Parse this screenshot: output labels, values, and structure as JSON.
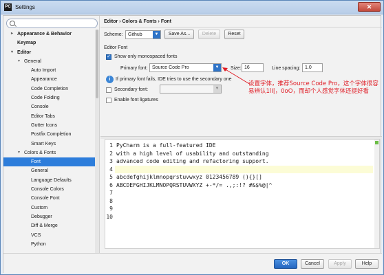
{
  "window": {
    "title": "Settings",
    "app_icon": "PC",
    "close": "✕"
  },
  "sidebar": {
    "search_placeholder": "",
    "items": [
      {
        "label": "Appearance & Behavior",
        "bold": true,
        "arrow": "▸",
        "level": 0
      },
      {
        "label": "Keymap",
        "bold": true,
        "arrow": "",
        "level": 0
      },
      {
        "label": "Editor",
        "bold": true,
        "arrow": "▾",
        "level": 0
      },
      {
        "label": "General",
        "bold": false,
        "arrow": "▾",
        "level": 1
      },
      {
        "label": "Auto Import",
        "bold": false,
        "arrow": "",
        "level": 2
      },
      {
        "label": "Appearance",
        "bold": false,
        "arrow": "",
        "level": 2
      },
      {
        "label": "Code Completion",
        "bold": false,
        "arrow": "",
        "level": 2
      },
      {
        "label": "Code Folding",
        "bold": false,
        "arrow": "",
        "level": 2
      },
      {
        "label": "Console",
        "bold": false,
        "arrow": "",
        "level": 2
      },
      {
        "label": "Editor Tabs",
        "bold": false,
        "arrow": "",
        "level": 2
      },
      {
        "label": "Gutter Icons",
        "bold": false,
        "arrow": "",
        "level": 2
      },
      {
        "label": "Postfix Completion",
        "bold": false,
        "arrow": "",
        "level": 2
      },
      {
        "label": "Smart Keys",
        "bold": false,
        "arrow": "",
        "level": 2
      },
      {
        "label": "Colors & Fonts",
        "bold": false,
        "arrow": "▾",
        "level": 1
      },
      {
        "label": "Font",
        "bold": false,
        "arrow": "",
        "level": 2,
        "selected": true
      },
      {
        "label": "General",
        "bold": false,
        "arrow": "",
        "level": 2
      },
      {
        "label": "Language Defaults",
        "bold": false,
        "arrow": "",
        "level": 2
      },
      {
        "label": "Console Colors",
        "bold": false,
        "arrow": "",
        "level": 2
      },
      {
        "label": "Console Font",
        "bold": false,
        "arrow": "",
        "level": 2
      },
      {
        "label": "Custom",
        "bold": false,
        "arrow": "",
        "level": 2
      },
      {
        "label": "Debugger",
        "bold": false,
        "arrow": "",
        "level": 2
      },
      {
        "label": "Diff & Merge",
        "bold": false,
        "arrow": "",
        "level": 2
      },
      {
        "label": "VCS",
        "bold": false,
        "arrow": "",
        "level": 2
      },
      {
        "label": "Python",
        "bold": false,
        "arrow": "",
        "level": 2
      }
    ]
  },
  "content": {
    "breadcrumb": "Editor › Colors & Fonts › Font",
    "scheme_label": "Scheme:",
    "scheme_value": "Github",
    "save_as": "Save As...",
    "delete": "Delete",
    "reset": "Reset",
    "editor_font_header": "Editor Font",
    "monospaced_label": "Show only monospaced fonts",
    "primary_font_label": "Primary font:",
    "primary_font_value": "Source Code Pro",
    "size_label": "Size:",
    "size_value": "16",
    "line_spacing_label": "Line spacing:",
    "line_spacing_value": "1.0",
    "info_text": "If primary font fails, IDE tries to use the secondary one",
    "secondary_font_label": "Secondary font:",
    "ligatures_label": "Enable font ligatures"
  },
  "annotation": {
    "text": "设置字体，推荐Source Code Pro，这个字体很容易辨认1lI|，0oO，而却个人感觉字体还挺好看"
  },
  "preview": {
    "line_numbers": [
      "1",
      "2",
      "3",
      "4",
      "5",
      "6",
      "7",
      "8",
      "9",
      "10"
    ],
    "lines": [
      "PyCharm is a full-featured IDE",
      "with a high level of usability and outstanding",
      "advanced code editing and refactoring support.",
      "",
      "abcdefghijklmnopqrstuvwxyz 0123456789 (){}[]",
      "ABCDEFGHIJKLMNOPQRSTUVWXYZ +-*/= .,;:!? #&$%@|^",
      "",
      "",
      "",
      ""
    ]
  },
  "footer": {
    "ok": "OK",
    "cancel": "Cancel",
    "apply": "Apply",
    "help": "Help"
  },
  "colors": {
    "accent": "#2d7ddb",
    "annotation": "#e01b24"
  }
}
